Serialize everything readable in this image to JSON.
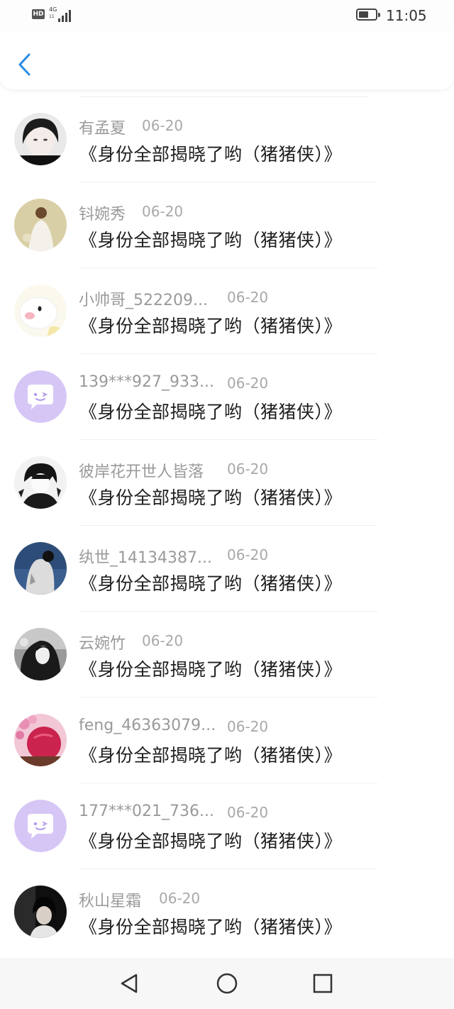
{
  "status_bar": {
    "badge": "HD",
    "network": "4G",
    "network_sub": "11",
    "time": "11:05"
  },
  "header": {
    "back_icon": "chevron-left-icon",
    "accent_color": "#2a8be3"
  },
  "list": {
    "items": [
      {
        "name": "有孟夏",
        "date": "06-20",
        "message": "《身份全部揭晓了哟（猪猪侠）》",
        "avatar": "photo-avatar"
      },
      {
        "name": "钭婉秀",
        "date": "06-20",
        "message": "《身份全部揭晓了哟（猪猪侠）》",
        "avatar": "photo-avatar"
      },
      {
        "name": "小帅哥_522209...",
        "date": "06-20",
        "message": "《身份全部揭晓了哟（猪猪侠）》",
        "avatar": "cartoon-avatar"
      },
      {
        "name": "139***927_933...",
        "date": "06-20",
        "message": "《身份全部揭晓了哟（猪猪侠）》",
        "avatar": "default-chat-avatar"
      },
      {
        "name": "彼岸花开世人皆落",
        "date": "06-20",
        "message": "《身份全部揭晓了哟（猪猪侠）》",
        "avatar": "anime-avatar"
      },
      {
        "name": "纨世_14134387...",
        "date": "06-20",
        "message": "《身份全部揭晓了哟（猪猪侠）》",
        "avatar": "photo-avatar"
      },
      {
        "name": "云婉竹",
        "date": "06-20",
        "message": "《身份全部揭晓了哟（猪猪侠）》",
        "avatar": "anime-avatar"
      },
      {
        "name": "feng_46363079...",
        "date": "06-20",
        "message": "《身份全部揭晓了哟（猪猪侠）》",
        "avatar": "photo-avatar"
      },
      {
        "name": "177***021_736...",
        "date": "06-20",
        "message": "《身份全部揭晓了哟（猪猪侠）》",
        "avatar": "default-chat-avatar"
      },
      {
        "name": "秋山星霜",
        "date": "06-20",
        "message": "《身份全部揭晓了哟（猪猪侠）》",
        "avatar": "photo-avatar"
      }
    ]
  },
  "nav_bar": {
    "back": "triangle-back-icon",
    "home": "circle-home-icon",
    "recents": "square-recents-icon"
  }
}
